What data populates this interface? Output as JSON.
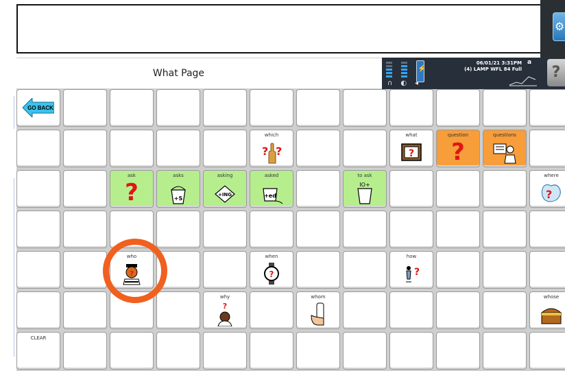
{
  "header": {
    "title": "What Page",
    "datetime": "06/01/21 3:31PM",
    "vocab": "(4) LAMP WFL 84 Full",
    "mode": "a"
  },
  "nav": {
    "go_back": "GO BACK"
  },
  "cells": {
    "which": "which",
    "what": "what",
    "question": "question",
    "questions": "questions",
    "ask": "ask",
    "asks": "asks",
    "asks_tag": "+S",
    "asking": "asking",
    "asking_tag": "+ING",
    "asked": "asked",
    "asked_tag": "+ed",
    "to_ask": "to ask",
    "to_ask_tag": "IO+",
    "where": "where",
    "who": "who",
    "when": "when",
    "how": "how",
    "why": "why",
    "whom": "whom",
    "whose": "whose",
    "clear": "CLEAR"
  },
  "colors": {
    "accent_green": "#b6ee8e",
    "accent_orange": "#f79d3a",
    "highlight_circle": "#f0601f"
  }
}
